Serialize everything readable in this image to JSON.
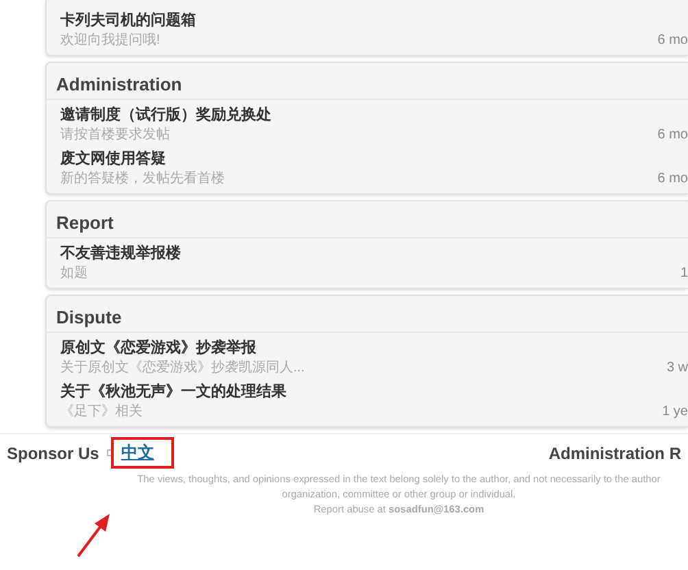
{
  "sections": [
    {
      "items": [
        {
          "title": "卡列夫司机的问题箱",
          "description": "欢迎向我提问哦!",
          "time": "6 mo"
        }
      ]
    },
    {
      "title": "Administration",
      "items": [
        {
          "title": "邀请制度（试行版）奖励兑换处",
          "description": "请按首楼要求发帖",
          "time": "6 mo"
        },
        {
          "title": "废文网使用答疑",
          "description": "新的答疑楼，发帖先看首楼",
          "time": "6 mo"
        }
      ]
    },
    {
      "title": "Report",
      "items": [
        {
          "title": "不友善违规举报楼",
          "description": "如题",
          "time": "1"
        }
      ]
    },
    {
      "title": "Dispute",
      "items": [
        {
          "title": "原创文《恋爱游戏》抄袭举报",
          "description": "关于原创文《恋爱游戏》抄袭凯源同人...",
          "time": "3 w"
        },
        {
          "title": "关于《秋池无声》一文的处理结果",
          "description": "《足下》相关",
          "time": "1 ye"
        }
      ]
    }
  ],
  "footer": {
    "sponsor": "Sponsor Us",
    "language": "中文",
    "admin": "Administration R",
    "disclaimer": [
      "The views, thoughts, and opinions expressed in the text belong solely to the author, and not necessarily to the author",
      "organization, committee or other group or individual."
    ],
    "report": "Report abuse at **sosadfun@163.com**"
  }
}
